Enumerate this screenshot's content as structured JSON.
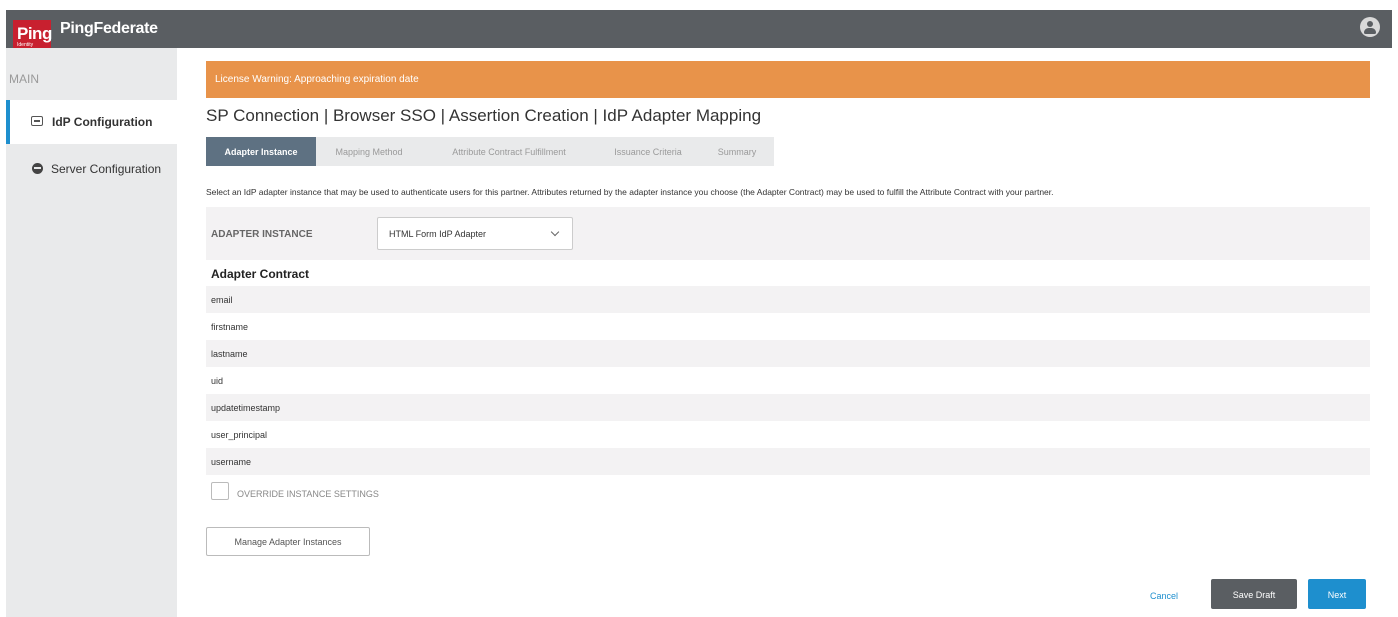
{
  "brand": {
    "logo_text": "Ping",
    "logo_subtext": "Identity",
    "product_name": "PingFederate"
  },
  "header": {
    "user_icon": "user-avatar-icon"
  },
  "sidebar": {
    "section_label": "MAIN",
    "items": [
      {
        "label": "IdP Configuration",
        "icon": "idp-card-icon",
        "active": true
      },
      {
        "label": "Server Configuration",
        "icon": "server-icon",
        "active": false
      }
    ]
  },
  "warning": {
    "text": "License Warning: Approaching expiration date",
    "color": "#e8934a"
  },
  "page": {
    "title": "SP Connection | Browser SSO | Assertion Creation | IdP Adapter Mapping"
  },
  "tabs": [
    {
      "label": "Adapter Instance",
      "active": true
    },
    {
      "label": "Mapping Method",
      "active": false
    },
    {
      "label": "Attribute Contract Fulfillment",
      "active": false
    },
    {
      "label": "Issuance Criteria",
      "active": false
    },
    {
      "label": "Summary",
      "active": false
    }
  ],
  "description": "Select an IdP adapter instance that may be used to authenticate users for this partner. Attributes returned by the adapter instance you choose (the Adapter Contract) may be used to fulfill the Attribute Contract with your partner.",
  "adapter_instance": {
    "label": "ADAPTER INSTANCE",
    "selected": "HTML Form IdP Adapter"
  },
  "adapter_contract": {
    "title": "Adapter Contract",
    "attributes": [
      "email",
      "firstname",
      "lastname",
      "uid",
      "updatetimestamp",
      "user_principal",
      "username"
    ]
  },
  "override": {
    "label": "OVERRIDE INSTANCE SETTINGS",
    "checked": false
  },
  "manage_button": "Manage Adapter Instances",
  "footer": {
    "cancel": "Cancel",
    "save_draft": "Save Draft",
    "next": "Next"
  },
  "colors": {
    "topbar": "#5a5e62",
    "accent": "#1e8fce",
    "logo": "#c8202f",
    "active_tab": "#5e7182"
  }
}
